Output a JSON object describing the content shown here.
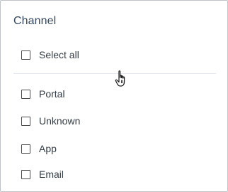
{
  "filter": {
    "title": "Channel",
    "select_all_label": "Select all",
    "options": [
      {
        "label": "Portal",
        "checked": false
      },
      {
        "label": "Unknown",
        "checked": false
      },
      {
        "label": "App",
        "checked": false
      },
      {
        "label": "Email",
        "checked": false
      }
    ]
  },
  "cursor": {
    "type": "hand-pointer-icon"
  },
  "colors": {
    "title": "#34475f",
    "text": "#333c45",
    "border": "#bfc3c8",
    "divider": "#e3e6ea"
  }
}
